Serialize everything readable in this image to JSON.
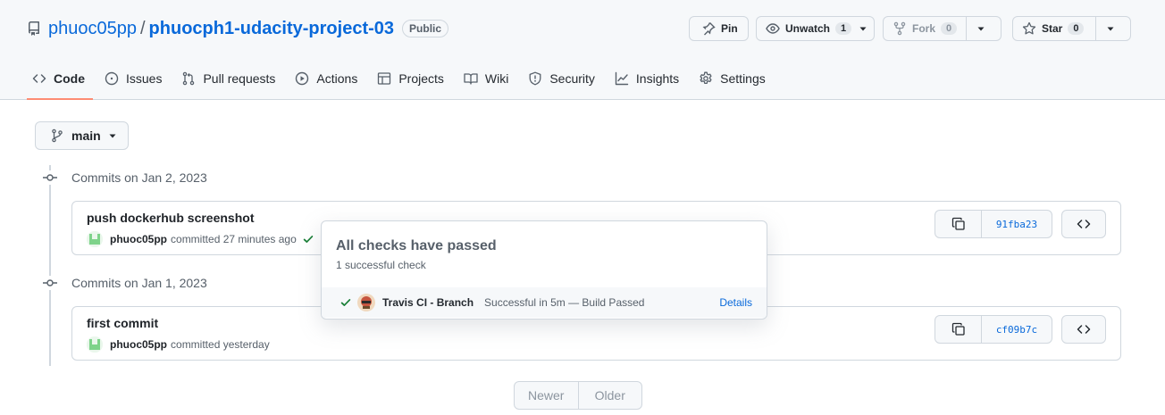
{
  "repo": {
    "owner": "phuoc05pp",
    "separator": "/",
    "name": "phuocph1-udacity-project-03",
    "visibility": "Public"
  },
  "actions": {
    "pin": "Pin",
    "unwatch": {
      "label": "Unwatch",
      "count": "1"
    },
    "fork": {
      "label": "Fork",
      "count": "0"
    },
    "star": {
      "label": "Star",
      "count": "0"
    }
  },
  "tabs": [
    {
      "label": "Code",
      "icon": "code-icon"
    },
    {
      "label": "Issues",
      "icon": "issue-icon"
    },
    {
      "label": "Pull requests",
      "icon": "pull-request-icon"
    },
    {
      "label": "Actions",
      "icon": "play-icon"
    },
    {
      "label": "Projects",
      "icon": "table-icon"
    },
    {
      "label": "Wiki",
      "icon": "book-icon"
    },
    {
      "label": "Security",
      "icon": "shield-icon"
    },
    {
      "label": "Insights",
      "icon": "graph-icon"
    },
    {
      "label": "Settings",
      "icon": "gear-icon"
    }
  ],
  "branch": {
    "name": "main"
  },
  "commit_groups": [
    {
      "label": "Commits on Jan 2, 2023",
      "commits": [
        {
          "title": "push dockerhub screenshot",
          "author": "phuoc05pp",
          "meta": "committed 27 minutes ago",
          "sha": "91fba23"
        }
      ]
    },
    {
      "label": "Commits on Jan 1, 2023",
      "commits": [
        {
          "title": "first commit",
          "author": "phuoc05pp",
          "meta": "committed yesterday",
          "sha": "cf09b7c"
        }
      ]
    }
  ],
  "checks_popover": {
    "title": "All checks have passed",
    "subtitle": "1 successful check",
    "check": {
      "name": "Travis CI - Branch",
      "description": "Successful in 5m — Build Passed",
      "details": "Details"
    }
  },
  "pagination": {
    "newer": "Newer",
    "older": "Older"
  },
  "colors": {
    "accent": "#0969da",
    "success": "#1a7f37",
    "tab_underline": "#fd8c73"
  }
}
